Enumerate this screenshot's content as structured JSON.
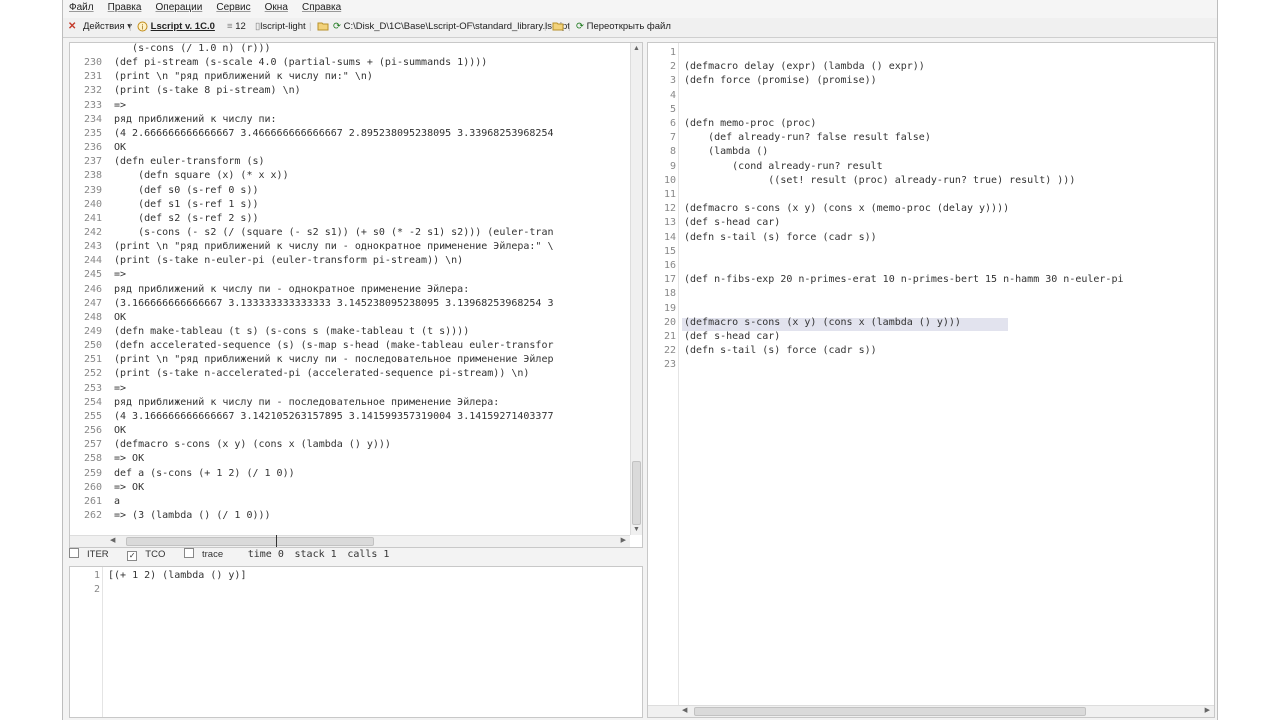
{
  "menu": [
    "Файл",
    "Правка",
    "Операции",
    "Сервис",
    "Окна",
    "Справка"
  ],
  "toolbar": {
    "actions": "Действия",
    "title": "Lscript v. 1C.0",
    "count": "12",
    "lscript_light": "lscript-light",
    "path": "C:\\Disk_D\\1C\\Base\\Lscript-OF\\standard_library.lscript",
    "reopen": "Переоткрыть файл"
  },
  "left_console": {
    "lines": [
      {
        "n": "",
        "t": "   (s-cons (/ 1.0 n) (r)))"
      },
      {
        "n": "230",
        "t": "(def pi-stream (s-scale 4.0 (partial-sums + (pi-summands 1))))"
      },
      {
        "n": "231",
        "t": "(print \\n \"ряд приближений к числу пи:\" \\n)"
      },
      {
        "n": "232",
        "t": "(print (s-take 8 pi-stream) \\n)"
      },
      {
        "n": "233",
        "t": "=>"
      },
      {
        "n": "234",
        "t": "ряд приближений к числу пи:"
      },
      {
        "n": "235",
        "t": "(4 2.666666666666667 3.466666666666667 2.895238095238095 3.33968253968254"
      },
      {
        "n": "236",
        "t": "OK"
      },
      {
        "n": "237",
        "t": "(defn euler-transform (s)"
      },
      {
        "n": "238",
        "t": "    (defn square (x) (* x x))"
      },
      {
        "n": "239",
        "t": "    (def s0 (s-ref 0 s))"
      },
      {
        "n": "240",
        "t": "    (def s1 (s-ref 1 s))"
      },
      {
        "n": "241",
        "t": "    (def s2 (s-ref 2 s))"
      },
      {
        "n": "242",
        "t": "    (s-cons (- s2 (/ (square (- s2 s1)) (+ s0 (* -2 s1) s2))) (euler-tran"
      },
      {
        "n": "243",
        "t": "(print \\n \"ряд приближений к числу пи - однократное применение Эйлера:\" \\"
      },
      {
        "n": "244",
        "t": "(print (s-take n-euler-pi (euler-transform pi-stream)) \\n)"
      },
      {
        "n": "245",
        "t": "=>"
      },
      {
        "n": "246",
        "t": "ряд приближений к числу пи - однократное применение Эйлера:"
      },
      {
        "n": "247",
        "t": "(3.166666666666667 3.133333333333333 3.145238095238095 3.13968253968254 3"
      },
      {
        "n": "248",
        "t": "OK"
      },
      {
        "n": "249",
        "t": "(defn make-tableau (t s) (s-cons s (make-tableau t (t s))))"
      },
      {
        "n": "250",
        "t": "(defn accelerated-sequence (s) (s-map s-head (make-tableau euler-transfor"
      },
      {
        "n": "251",
        "t": "(print \\n \"ряд приближений к числу пи - последовательное применение Эйлер"
      },
      {
        "n": "252",
        "t": "(print (s-take n-accelerated-pi (accelerated-sequence pi-stream)) \\n)"
      },
      {
        "n": "253",
        "t": "=>"
      },
      {
        "n": "254",
        "t": "ряд приближений к числу пи - последовательное применение Эйлера:"
      },
      {
        "n": "255",
        "t": "(4 3.166666666666667 3.142105263157895 3.141599357319004 3.14159271403377"
      },
      {
        "n": "256",
        "t": "OK"
      },
      {
        "n": "257",
        "t": "(defmacro s-cons (x y) (cons x (lambda () y)))"
      },
      {
        "n": "258",
        "t": "=> OK"
      },
      {
        "n": "259",
        "t": "def a (s-cons (+ 1 2) (/ 1 0))"
      },
      {
        "n": "260",
        "t": "=> OK"
      },
      {
        "n": "261",
        "t": "a"
      },
      {
        "n": "262",
        "t": "=> (3 (lambda () (/ 1 0)))"
      }
    ]
  },
  "status": {
    "iter": "ITER",
    "tco": "TCO",
    "trace": "trace",
    "time": "time 0",
    "stack": "stack 1",
    "calls": "calls 1"
  },
  "input_editor": {
    "lines": [
      {
        "n": "1",
        "t": "[(+ 1 2) (lambda () y)]"
      },
      {
        "n": "2",
        "t": ""
      }
    ]
  },
  "right_editor": {
    "lines": [
      {
        "n": "1",
        "t": ""
      },
      {
        "n": "2",
        "t": "(defmacro delay (expr) (lambda () expr))"
      },
      {
        "n": "3",
        "t": "(defn force (promise) (promise))"
      },
      {
        "n": "4",
        "t": ""
      },
      {
        "n": "5",
        "t": ""
      },
      {
        "n": "6",
        "t": "(defn memo-proc (proc)"
      },
      {
        "n": "7",
        "t": "    (def already-run? false result false)"
      },
      {
        "n": "8",
        "t": "    (lambda ()"
      },
      {
        "n": "9",
        "t": "        (cond already-run? result"
      },
      {
        "n": "10",
        "t": "              ((set! result (proc) already-run? true) result) )))"
      },
      {
        "n": "11",
        "t": ""
      },
      {
        "n": "12",
        "t": "(defmacro s-cons (x y) (cons x (memo-proc (delay y))))"
      },
      {
        "n": "13",
        "t": "(def s-head car)"
      },
      {
        "n": "14",
        "t": "(defn s-tail (s) force (cadr s))"
      },
      {
        "n": "15",
        "t": ""
      },
      {
        "n": "16",
        "t": ""
      },
      {
        "n": "17",
        "t": "(def n-fibs-exp 20 n-primes-erat 10 n-primes-bert 15 n-hamm 30 n-euler-pi"
      },
      {
        "n": "18",
        "t": ""
      },
      {
        "n": "19",
        "t": ""
      },
      {
        "n": "20",
        "t": "(defmacro s-cons (x y) (cons x (lambda () y)))"
      },
      {
        "n": "21",
        "t": "(def s-head car)"
      },
      {
        "n": "22",
        "t": "(defn s-tail (s) force (cadr s))"
      },
      {
        "n": "23",
        "t": ""
      }
    ]
  }
}
